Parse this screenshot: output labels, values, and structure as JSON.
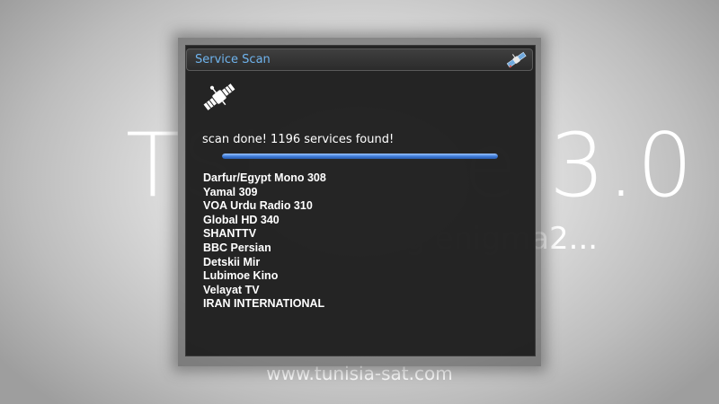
{
  "splash": {
    "title": "TSimage 3.0",
    "subtitle": "starting enigma2...",
    "watermark": "www.tunisia-sat.com"
  },
  "dialog": {
    "title": "Service Scan",
    "title_icon": "satellite-icon",
    "status_icon": "satellite-icon",
    "status_text": "scan done! 1196 services found!",
    "progress_percent": 100,
    "services": [
      "Darfur/Egypt Mono 308",
      "Yamal 309",
      "VOA Urdu Radio 310",
      "Global HD 340",
      "SHANTTV",
      "BBC Persian",
      "Detskii Mir",
      "Lubimoe Kino",
      "Velayat TV",
      "IRAN INTERNATIONAL"
    ]
  },
  "colors": {
    "title_text": "#6fb4ee",
    "progress": "#3d7ad8",
    "dialog_bg": "#262626"
  }
}
